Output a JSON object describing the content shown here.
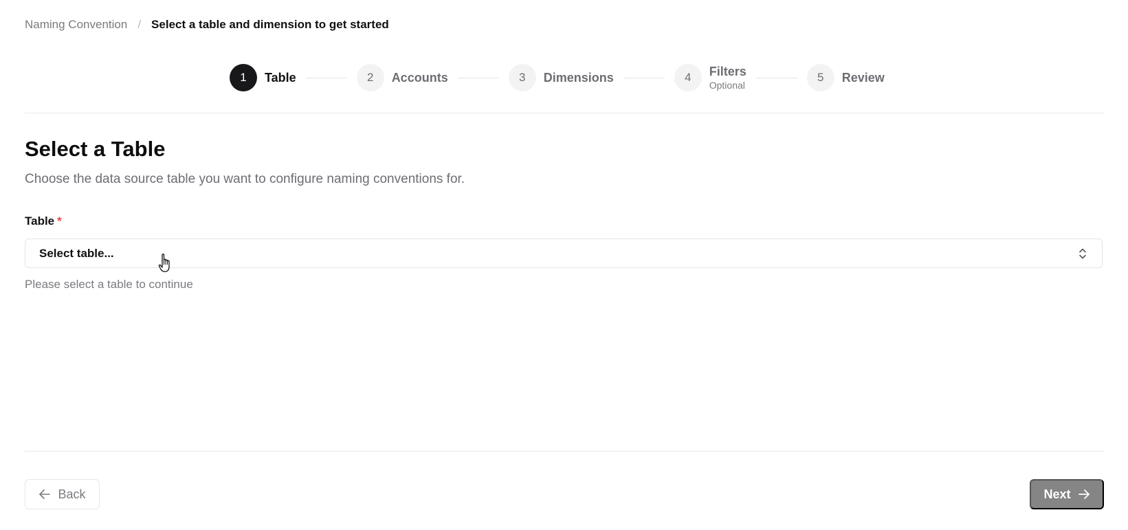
{
  "breadcrumb": {
    "parent": "Naming Convention",
    "separator": "/",
    "current": "Select a table and dimension to get started"
  },
  "stepper": {
    "steps": [
      {
        "number": "1",
        "label": "Table",
        "sublabel": "",
        "state": "active"
      },
      {
        "number": "2",
        "label": "Accounts",
        "sublabel": "",
        "state": "upcoming"
      },
      {
        "number": "3",
        "label": "Dimensions",
        "sublabel": "",
        "state": "upcoming"
      },
      {
        "number": "4",
        "label": "Filters",
        "sublabel": "Optional",
        "state": "upcoming"
      },
      {
        "number": "5",
        "label": "Review",
        "sublabel": "",
        "state": "upcoming"
      }
    ]
  },
  "main": {
    "title": "Select a Table",
    "description": "Choose the data source table you want to configure naming conventions for.",
    "field": {
      "label": "Table",
      "required_mark": "*",
      "value": "Select table...",
      "hint": "Please select a table to continue",
      "icon": "chevrons-up-down-icon"
    }
  },
  "footer": {
    "back_label": "Back",
    "back_icon": "arrow-left-icon",
    "next_label": "Next",
    "next_icon": "arrow-right-icon"
  },
  "colors": {
    "active_step": "#18181b",
    "inactive_step_bg": "#f3f3f4",
    "next_button_disabled": "#858585",
    "required": "#e5484d"
  }
}
